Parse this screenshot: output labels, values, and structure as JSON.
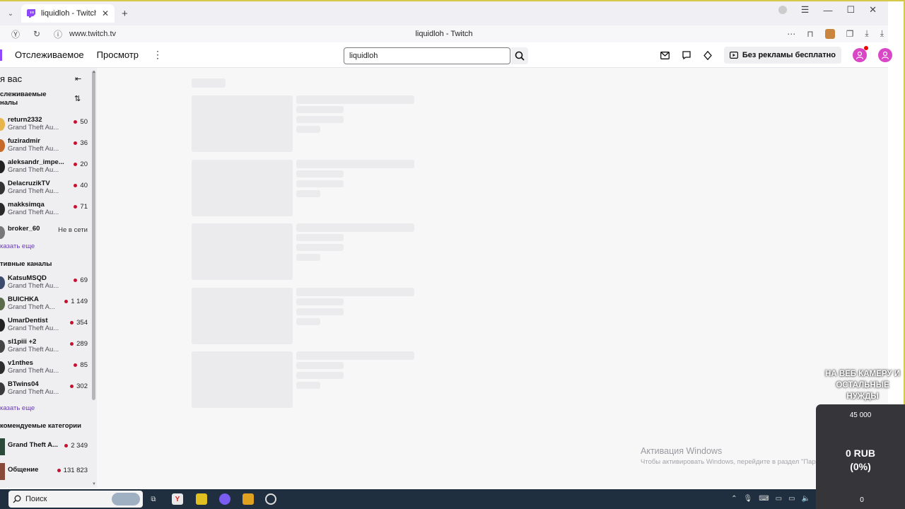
{
  "browser": {
    "tab_title": "liquidloh - Twitch",
    "url": "www.twitch.tv",
    "page_title": "liquidloh - Twitch"
  },
  "topnav": {
    "following": "Отслеживаемое",
    "browse": "Просмотр",
    "search_value": "liquidloh",
    "no_ads": "Без рекламы бесплатно"
  },
  "sidebar": {
    "header": "я вас",
    "followed_heading_line1": "слеживаемые",
    "followed_heading_line2": "налы",
    "followed": [
      {
        "name": "return2332",
        "game": "Grand Theft Au...",
        "viewers": "50",
        "color": "#e8b54a"
      },
      {
        "name": "fuziradmir",
        "game": "Grand Theft Au...",
        "viewers": "36",
        "color": "#c56a2a"
      },
      {
        "name": "aleksandr_impe...",
        "game": "Grand Theft Au...",
        "viewers": "20",
        "color": "#222222"
      },
      {
        "name": "DelacruzikTV",
        "game": "Grand Theft Au...",
        "viewers": "40",
        "color": "#333333"
      },
      {
        "name": "makksimqa",
        "game": "Grand Theft Au...",
        "viewers": "71",
        "color": "#2a2a2a"
      }
    ],
    "offline_channel": {
      "name": "broker_60",
      "status": "Не в сети",
      "color": "#777777"
    },
    "show_more_1": "казать еще",
    "active_heading": "тивные каналы",
    "active": [
      {
        "name": "KatsuMSQD",
        "game": "Grand Theft Au...",
        "viewers": "69",
        "color": "#3b4b6b"
      },
      {
        "name": "BUICHKA",
        "game": "Grand Theft A...",
        "viewers": "1 149",
        "color": "#5a6a4a"
      },
      {
        "name": "UmarDentist",
        "game": "Grand Theft Au...",
        "viewers": "354",
        "color": "#222222"
      },
      {
        "name": "sl1piii +2",
        "game": "Grand Theft Au...",
        "viewers": "289",
        "color": "#444444"
      },
      {
        "name": "v1nthes",
        "game": "Grand Theft Au...",
        "viewers": "85",
        "color": "#2d2d2d"
      },
      {
        "name": "BTwins04",
        "game": "Grand Theft Au...",
        "viewers": "302",
        "color": "#3a3a3a"
      }
    ],
    "show_more_2": "казать еще",
    "recommended_heading": "комендуемые категории",
    "categories": [
      {
        "name": "Grand Theft A...",
        "viewers": "2 349",
        "color": "#2c4a3a"
      },
      {
        "name": "Общение",
        "viewers": "131 823",
        "color": "#8a4a3a"
      }
    ]
  },
  "watermark": {
    "line1": "Активация Windows",
    "line2": "Чтобы активировать Windows, перейдите в раздел \"Параметры\"."
  },
  "overlay": {
    "text_line1": "НА ВЕБ КАМЕРУ И",
    "text_line2": "ОСТАЛЬНЫЕ",
    "text_line3": "НУЖДЫ",
    "goal": "45 000",
    "amount_line1": "0 RUB",
    "amount_line2": "(0%)",
    "zero": "0"
  },
  "taskbar": {
    "search_label": "Поиск"
  },
  "colors": {
    "twitch_purple": "#9147ff",
    "live_red": "#c8102e",
    "avatar_pink": "#d946c6"
  }
}
